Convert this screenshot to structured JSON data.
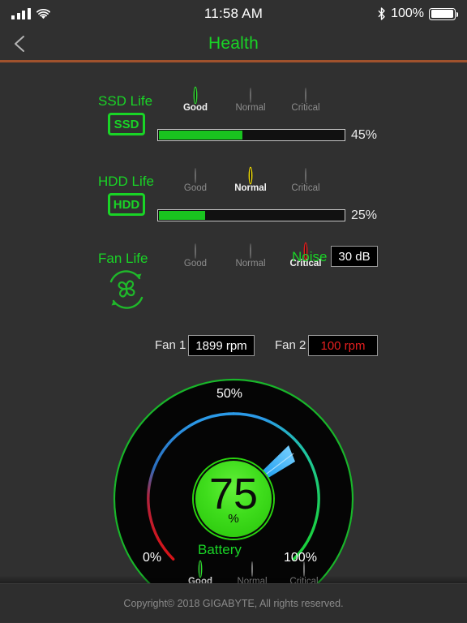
{
  "status_bar": {
    "time": "11:58 AM",
    "battery_percent": "100%",
    "signal_icon": "cellular-signal-icon",
    "wifi_icon": "wifi-icon",
    "bluetooth_icon": "bluetooth-icon",
    "battery_icon": "battery-full-icon"
  },
  "nav": {
    "back_icon": "chevron-left-icon",
    "title": "Health",
    "accent_color": "#19d426",
    "rule_color": "#a0522d"
  },
  "ssd": {
    "title": "SSD Life",
    "badge": "SSD",
    "status_options": [
      "Good",
      "Normal",
      "Critical"
    ],
    "status_selected": "Good",
    "progress_value": 45,
    "progress_label": "45%",
    "bar_color": "#19c41f"
  },
  "hdd": {
    "title": "HDD Life",
    "badge": "HDD",
    "status_options": [
      "Good",
      "Normal",
      "Critical"
    ],
    "status_selected": "Normal",
    "progress_value": 25,
    "progress_label": "25%",
    "bar_color": "#19c41f"
  },
  "fan": {
    "title": "Fan Life",
    "icon": "fan-icon",
    "status_options": [
      "Good",
      "Normal",
      "Critical"
    ],
    "status_selected": "Critical",
    "noise_label": "Noise",
    "noise_value": "30 dB",
    "fan1_label": "Fan 1",
    "fan1_value": "1899 rpm",
    "fan2_label": "Fan 2",
    "fan2_value": "100 rpm",
    "fan2_color": "#e51f1f"
  },
  "battery_gauge": {
    "title": "Battery",
    "value": "75",
    "unit": "%",
    "min_label": "0%",
    "mid_label": "50%",
    "max_label": "100%",
    "status_options": [
      "Good",
      "Normal",
      "Critical"
    ],
    "status_selected": "Good",
    "arc_colors": [
      "#e01010",
      "#1f8fe8",
      "#19d426"
    ],
    "needle_color": "#1f9ff0"
  },
  "footer": {
    "copyright": "Copyright© 2018 GIGABYTE, All rights reserved."
  },
  "chart_data": {
    "type": "gauge",
    "title": "Battery",
    "value": 75,
    "unit": "%",
    "min": 0,
    "max": 100,
    "ticks": [
      0,
      50,
      100
    ],
    "tick_labels": [
      "0%",
      "50%",
      "100%"
    ],
    "status": "Good",
    "bars": [
      {
        "name": "SSD Life",
        "value": 45,
        "label": "45%",
        "status": "Good"
      },
      {
        "name": "HDD Life",
        "value": 25,
        "label": "25%",
        "status": "Normal"
      }
    ],
    "readouts": [
      {
        "name": "Noise",
        "value": "30 dB"
      },
      {
        "name": "Fan 1",
        "value": "1899 rpm"
      },
      {
        "name": "Fan 2",
        "value": "100 rpm"
      }
    ]
  }
}
